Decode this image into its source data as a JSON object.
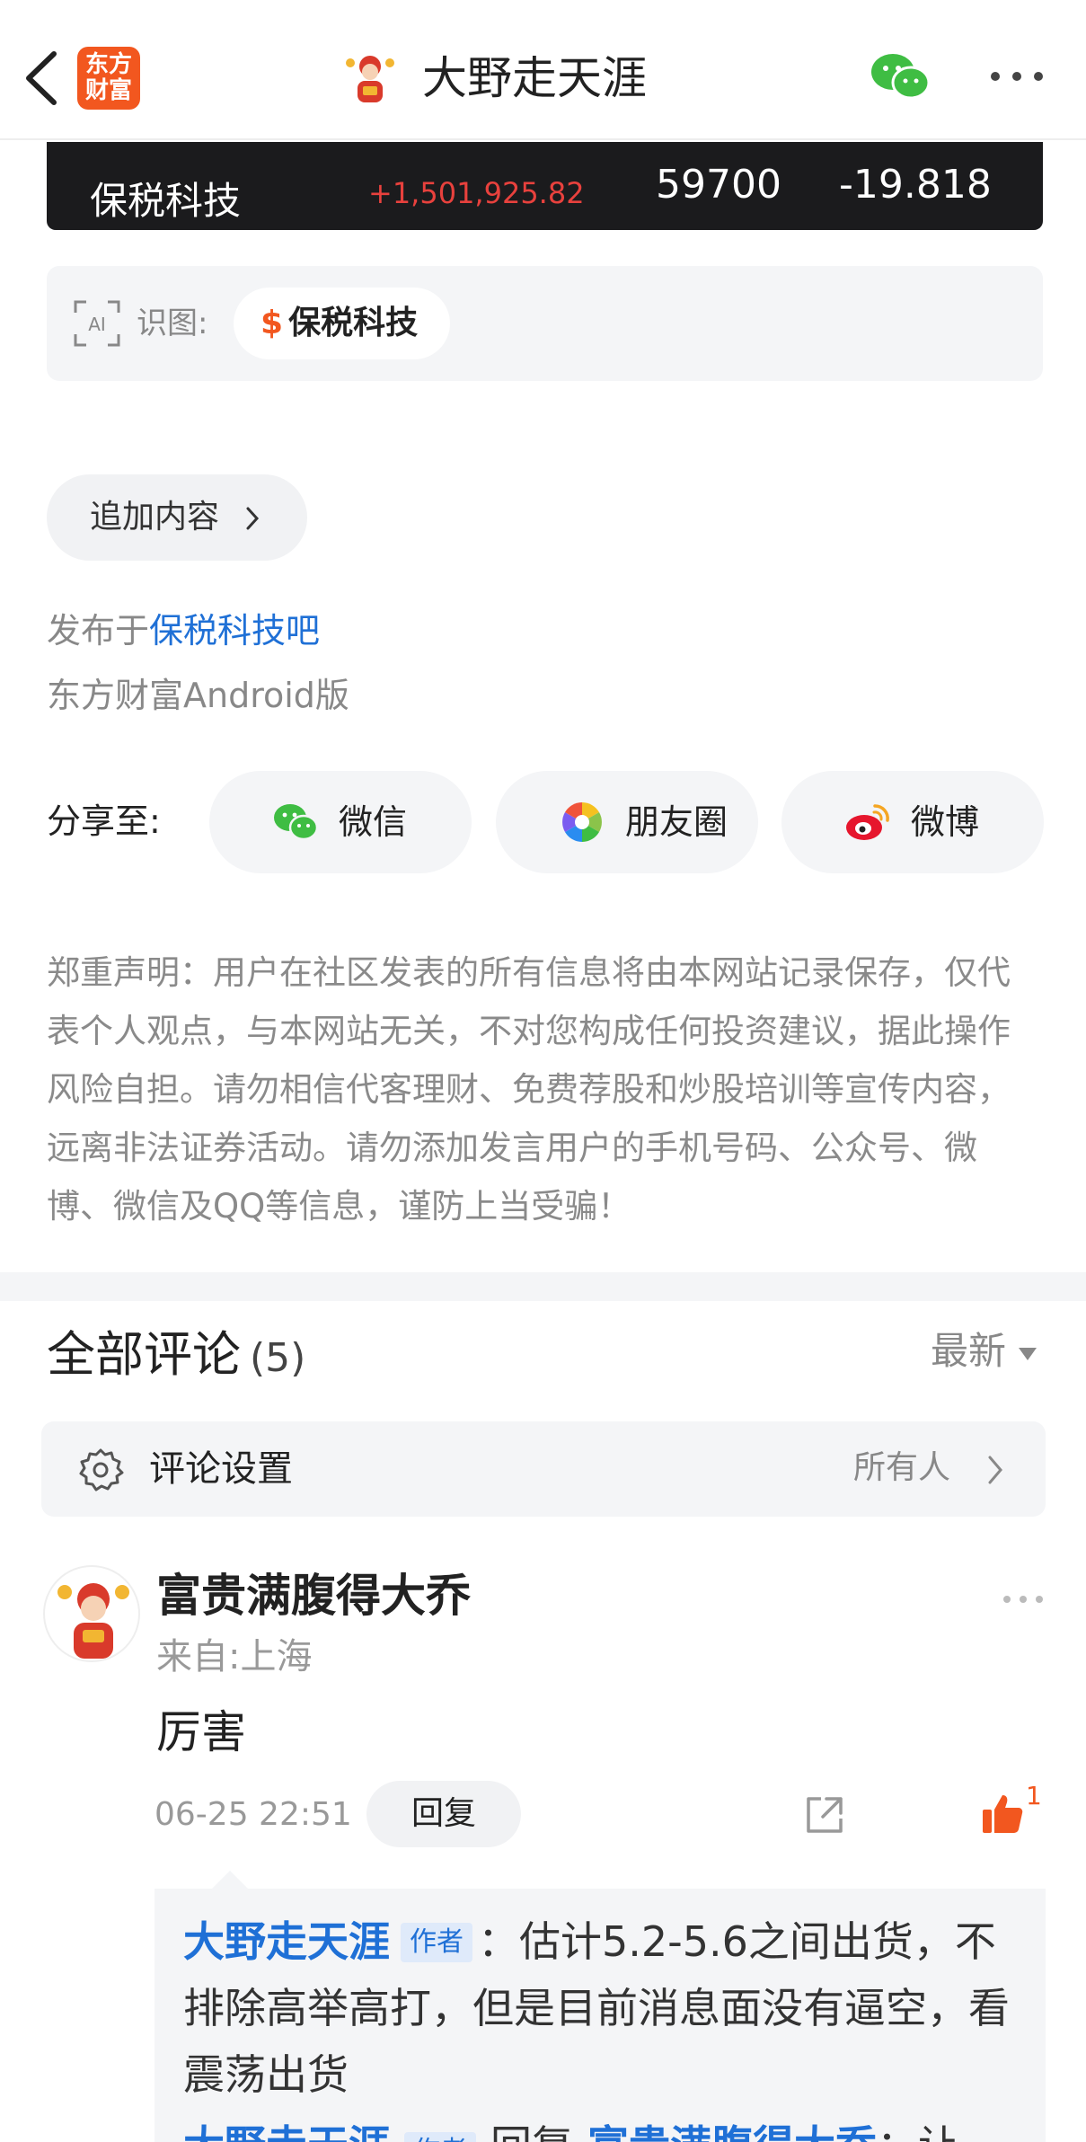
{
  "header": {
    "logo_line1": "东方",
    "logo_line2": "财富",
    "title": "大野走天涯",
    "colors": {
      "brand": "#f2571f",
      "link": "#1f70d6",
      "wechat": "#3fbd43"
    }
  },
  "stock_bar": {
    "name": "保税科技",
    "amount": "+1,501,925.82",
    "volume": "59700",
    "percent": "-19.818"
  },
  "ai_recognition": {
    "label": "识图:",
    "chip_symbol": "$",
    "chip_label": "保税科技"
  },
  "add_content": {
    "label": "追加内容"
  },
  "publish": {
    "prefix": "发布于",
    "bar_name": "保税科技吧",
    "device": "东方财富Android版"
  },
  "share": {
    "label": "分享至:",
    "targets": [
      {
        "label": "微信",
        "icon": "wechat-icon"
      },
      {
        "label": "朋友圈",
        "icon": "moments-icon"
      },
      {
        "label": "微博",
        "icon": "weibo-icon"
      }
    ]
  },
  "disclaimer": "郑重声明：用户在社区发表的所有信息将由本网站记录保存，仅代表个人观点，与本网站无关，不对您构成任何投资建议，据此操作风险自担。请勿相信代客理财、免费荐股和炒股培训等宣传内容，远离非法证券活动。请勿添加发言用户的手机号码、公众号、微博、微信及QQ等信息，谨防上当受骗！",
  "comments": {
    "title": "全部评论",
    "count": "(5)",
    "sort_label": "最新",
    "settings": {
      "label": "评论设置",
      "value": "所有人"
    },
    "items": [
      {
        "user": "富贵满腹得大乔",
        "from": "来自:上海",
        "text": "厉害",
        "time": "06-25 22:51",
        "reply_label": "回复",
        "likes": "1",
        "replies": [
          {
            "author": "大野走天涯",
            "tag": "作者",
            "text": "：估计5.2-5.6之间出货，不排除高举高打，但是目前消息面没有逼空，看震荡出货"
          }
        ],
        "cut_reply": {
          "author": "大野走天涯",
          "tag": "作者",
          "verb": "回复",
          "target": "富贵满腹得大乔",
          "tail": "：让"
        }
      }
    ]
  }
}
